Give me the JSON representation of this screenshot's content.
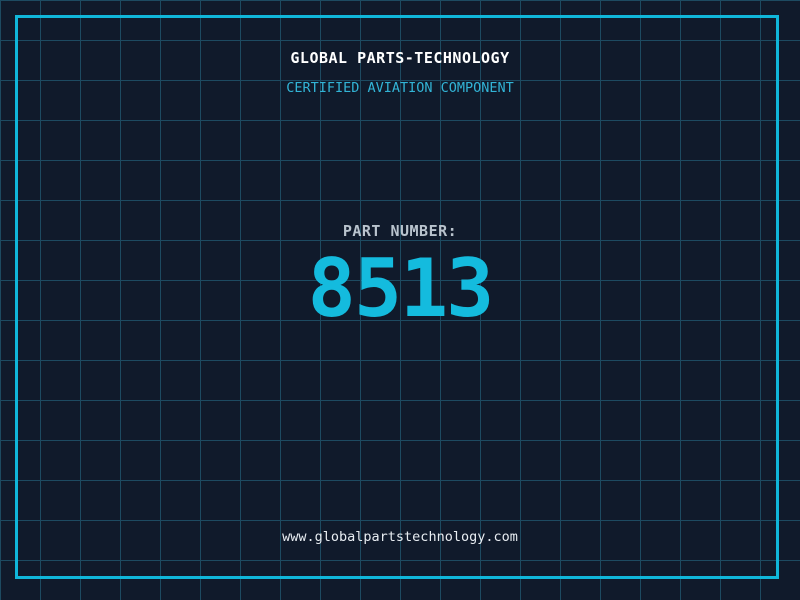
{
  "header": {
    "title": "GLOBAL PARTS-TECHNOLOGY",
    "subtitle": "CERTIFIED AVIATION COMPONENT"
  },
  "part": {
    "label": "PART NUMBER:",
    "number": "8513"
  },
  "footer": {
    "url": "www.globalpartstechnology.com"
  },
  "colors": {
    "background": "#101a2b",
    "grid_line": "#1d4a61",
    "frame": "#10b6da",
    "title_text": "#ffffff",
    "subtitle_text": "#32b4d6",
    "label_text": "#b9c3cd",
    "number_text": "#14bbde",
    "url_text": "#e8edf2"
  }
}
